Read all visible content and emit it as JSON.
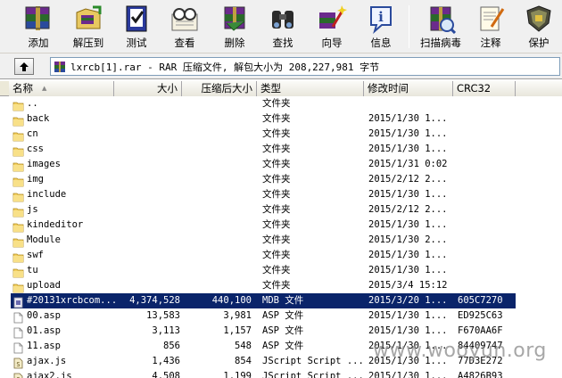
{
  "toolbar": {
    "buttons": [
      {
        "label": "添加",
        "icon": "add-archive-icon"
      },
      {
        "label": "解压到",
        "icon": "extract-to-icon"
      },
      {
        "label": "测试",
        "icon": "test-icon"
      },
      {
        "label": "查看",
        "icon": "view-icon"
      },
      {
        "label": "删除",
        "icon": "delete-icon"
      },
      {
        "label": "查找",
        "icon": "find-icon"
      },
      {
        "label": "向导",
        "icon": "wizard-icon"
      },
      {
        "label": "信息",
        "icon": "info-icon"
      },
      {
        "label": "扫描病毒",
        "icon": "virus-scan-icon"
      },
      {
        "label": "注释",
        "icon": "comment-icon"
      },
      {
        "label": "保护",
        "icon": "protect-icon"
      }
    ]
  },
  "address": {
    "text": "lxrcb[1].rar - RAR 压缩文件, 解包大小为 208,227,981 字节"
  },
  "columns": [
    "名称",
    "大小",
    "压缩后大小",
    "类型",
    "修改时间",
    "CRC32"
  ],
  "rows": [
    {
      "name": "..",
      "size": "",
      "packed": "",
      "type": "文件夹",
      "modified": "",
      "crc": "",
      "kind": "folder"
    },
    {
      "name": "back",
      "size": "",
      "packed": "",
      "type": "文件夹",
      "modified": "2015/1/30 1...",
      "crc": "",
      "kind": "folder"
    },
    {
      "name": "cn",
      "size": "",
      "packed": "",
      "type": "文件夹",
      "modified": "2015/1/30 1...",
      "crc": "",
      "kind": "folder"
    },
    {
      "name": "css",
      "size": "",
      "packed": "",
      "type": "文件夹",
      "modified": "2015/1/30 1...",
      "crc": "",
      "kind": "folder"
    },
    {
      "name": "images",
      "size": "",
      "packed": "",
      "type": "文件夹",
      "modified": "2015/1/31 0:02",
      "crc": "",
      "kind": "folder"
    },
    {
      "name": "img",
      "size": "",
      "packed": "",
      "type": "文件夹",
      "modified": "2015/2/12 2...",
      "crc": "",
      "kind": "folder"
    },
    {
      "name": "include",
      "size": "",
      "packed": "",
      "type": "文件夹",
      "modified": "2015/1/30 1...",
      "crc": "",
      "kind": "folder"
    },
    {
      "name": "js",
      "size": "",
      "packed": "",
      "type": "文件夹",
      "modified": "2015/2/12 2...",
      "crc": "",
      "kind": "folder"
    },
    {
      "name": "kindeditor",
      "size": "",
      "packed": "",
      "type": "文件夹",
      "modified": "2015/1/30 1...",
      "crc": "",
      "kind": "folder"
    },
    {
      "name": "Module",
      "size": "",
      "packed": "",
      "type": "文件夹",
      "modified": "2015/1/30 2...",
      "crc": "",
      "kind": "folder"
    },
    {
      "name": "swf",
      "size": "",
      "packed": "",
      "type": "文件夹",
      "modified": "2015/1/30 1...",
      "crc": "",
      "kind": "folder"
    },
    {
      "name": "tu",
      "size": "",
      "packed": "",
      "type": "文件夹",
      "modified": "2015/1/30 1...",
      "crc": "",
      "kind": "folder"
    },
    {
      "name": "upload",
      "size": "",
      "packed": "",
      "type": "文件夹",
      "modified": "2015/3/4 15:12",
      "crc": "",
      "kind": "folder"
    },
    {
      "name": "#20131xrcbcom...",
      "size": "4,374,528",
      "packed": "440,100",
      "type": "MDB 文件",
      "modified": "2015/3/20 1...",
      "crc": "605C7270",
      "kind": "mdb",
      "selected": true
    },
    {
      "name": "00.asp",
      "size": "13,583",
      "packed": "3,981",
      "type": "ASP 文件",
      "modified": "2015/1/30 1...",
      "crc": "ED925C63",
      "kind": "file"
    },
    {
      "name": "01.asp",
      "size": "3,113",
      "packed": "1,157",
      "type": "ASP 文件",
      "modified": "2015/1/30 1...",
      "crc": "F670AA6F",
      "kind": "file"
    },
    {
      "name": "11.asp",
      "size": "856",
      "packed": "548",
      "type": "ASP 文件",
      "modified": "2015/1/30 1...",
      "crc": "84409747",
      "kind": "file"
    },
    {
      "name": "ajax.js",
      "size": "1,436",
      "packed": "854",
      "type": "JScript Script ...",
      "modified": "2015/1/30 1...",
      "crc": "77D3E272",
      "kind": "script"
    },
    {
      "name": "ajax2.js",
      "size": "4,508",
      "packed": "1,199",
      "type": "JScript Script ...",
      "modified": "2015/1/30 1...",
      "crc": "A4826B93",
      "kind": "script"
    }
  ],
  "watermark": "www.wooyun.org"
}
